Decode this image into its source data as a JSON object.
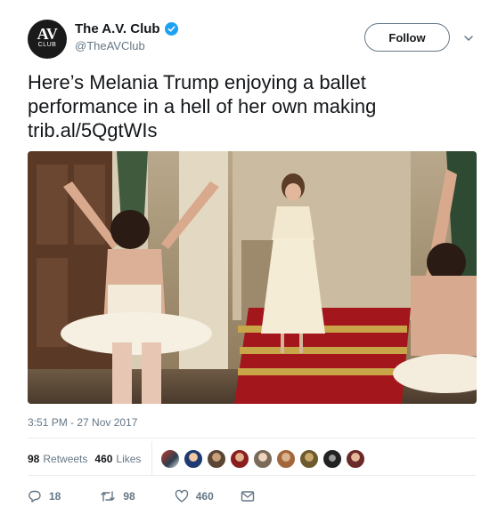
{
  "author": {
    "avatar_top": "AV",
    "avatar_bottom": "CLUB",
    "name": "The A.V. Club",
    "handle": "@TheAVClub",
    "verified": true
  },
  "header": {
    "follow_label": "Follow"
  },
  "tweet": {
    "text_line1": "Here’s Melania Trump enjoying a ballet",
    "text_line2": "performance in a hell of her own making",
    "link": "trib.al/5QgtWIs",
    "timestamp": "3:51 PM - 27 Nov 2017"
  },
  "stats": {
    "retweets_count": "98",
    "retweets_label": "Retweets",
    "likes_count": "460",
    "likes_label": "Likes"
  },
  "actions": {
    "reply_count": "18",
    "retweet_count": "98",
    "like_count": "460"
  },
  "colors": {
    "accent": "#1da1f2",
    "muted": "#657786",
    "text": "#14171a",
    "divider": "#e6ecf0"
  }
}
